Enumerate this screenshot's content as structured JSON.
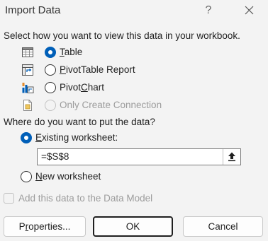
{
  "window": {
    "title": "Import Data",
    "help_glyph": "?"
  },
  "view_section": {
    "prompt": "Select how you want to view this data in your workbook.",
    "options": [
      {
        "label": "Table",
        "accel": "T",
        "rest": "able",
        "checked": true,
        "disabled": false,
        "icon": "table-icon"
      },
      {
        "label": "PivotTable Report",
        "accel": "P",
        "rest": "ivotTable Report",
        "checked": false,
        "disabled": false,
        "icon": "pivottable-icon"
      },
      {
        "label": "PivotChart",
        "prefix": "Pivot",
        "accel": "C",
        "rest": "hart",
        "checked": false,
        "disabled": false,
        "icon": "pivotchart-icon"
      },
      {
        "label": "Only Create Connection",
        "checked": false,
        "disabled": true,
        "icon": "connection-only-icon"
      }
    ]
  },
  "put_section": {
    "prompt": "Where do you want to put the data?",
    "existing": {
      "label": "Existing worksheet:",
      "accel": "E",
      "rest": "xisting worksheet:",
      "checked": true
    },
    "reference_value": "=$S$8",
    "new": {
      "label": "New worksheet",
      "accel": "N",
      "rest": "ew worksheet",
      "checked": false
    }
  },
  "data_model": {
    "label": "Add this data to the Data Model",
    "checked": false,
    "disabled": true
  },
  "buttons": {
    "properties": {
      "label": "Properties...",
      "prefix": "P",
      "accel": "r",
      "rest": "operties..."
    },
    "ok": "OK",
    "cancel": "Cancel"
  },
  "colors": {
    "accent": "#005fb8",
    "background": "#f3f3f3",
    "disabled_text": "#9c9c9c"
  }
}
